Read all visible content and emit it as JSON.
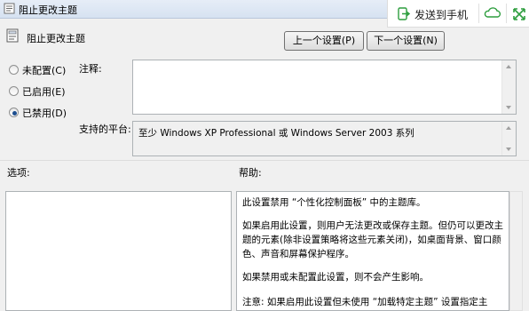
{
  "window": {
    "title": "阻止更改主题"
  },
  "extension_toolbar": {
    "send_label": "发送到手机",
    "send_icon": "send-to-phone-icon",
    "cloud_icon": "cloud-icon",
    "expand_icon": "expand-icon",
    "accent": "#2e9e3f"
  },
  "policy": {
    "name": "阻止更改主题"
  },
  "nav": {
    "prev_label": "上一个设置(P)",
    "next_label": "下一个设置(N)"
  },
  "state": {
    "options": [
      {
        "label": "未配置(C)",
        "selected": false
      },
      {
        "label": "已启用(E)",
        "selected": false
      },
      {
        "label": "已禁用(D)",
        "selected": true
      }
    ]
  },
  "comment": {
    "label": "注释:",
    "value": ""
  },
  "supported": {
    "label": "支持的平台:",
    "value": "至少 Windows XP Professional 或 Windows Server 2003 系列"
  },
  "options_pane": {
    "label": "选项:"
  },
  "help_pane": {
    "label": "帮助:",
    "paragraphs": [
      "此设置禁用 “个性化控制面板” 中的主题库。",
      "如果启用此设置，则用户无法更改或保存主题。但仍可以更改主题的元素(除非设置策略将这些元素关闭)，如桌面背景、窗口颜色、声音和屏幕保护程序。",
      "如果禁用或未配置此设置，则不会产生影响。",
      "注意: 如果启用此设置但未使用 “加载特定主题” 设置指定主题，"
    ]
  }
}
